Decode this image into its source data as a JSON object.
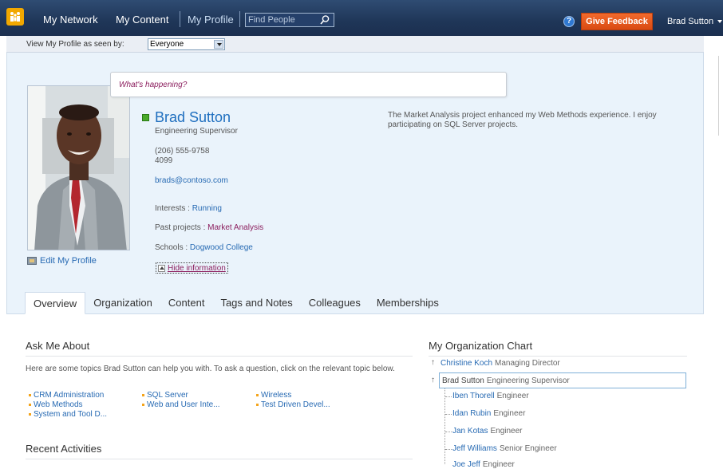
{
  "topnav": {
    "links": [
      "My Network",
      "My Content",
      "My Profile"
    ],
    "find_placeholder": "Find People",
    "feedback": "Give Feedback",
    "user": "Brad Sutton",
    "help": "?"
  },
  "subbar": {
    "label": "View My Profile as seen by:",
    "selected": "Everyone"
  },
  "status_bubble": "What's happening?",
  "profile": {
    "name": "Brad Sutton",
    "title": "Engineering Supervisor",
    "phone": "(206) 555-9758",
    "extension": "4099",
    "email": "brads@contoso.com",
    "interests_label": "Interests :",
    "interests_value": "Running",
    "past_projects_label": "Past projects :",
    "past_projects_value": "Market Analysis",
    "schools_label": "Schools :",
    "schools_value": "Dogwood College",
    "hide_info": "Hide information",
    "edit_profile": "Edit My Profile",
    "about": "The Market Analysis project enhanced my Web Methods experience. I enjoy participating on SQL Server projects."
  },
  "tabs": [
    "Overview",
    "Organization",
    "Content",
    "Tags and Notes",
    "Colleagues",
    "Memberships"
  ],
  "ask_me_about": {
    "title": "Ask Me About",
    "description": "Here are some topics Brad Sutton can help you with. To ask a question, click on the relevant topic below.",
    "topics": [
      "CRM Administration",
      "Web Methods",
      "System and Tool D...",
      "SQL Server",
      "Web and User Inte...",
      "Wireless",
      "Test Driven Devel..."
    ]
  },
  "recent_activities": {
    "title": "Recent Activities"
  },
  "org_chart": {
    "title": "My Organization Chart",
    "manager": {
      "name": "Christine Koch",
      "title": "Managing Director"
    },
    "self": {
      "name": "Brad Sutton",
      "title": "Engineering Supervisor"
    },
    "reports": [
      {
        "name": "Iben Thorell",
        "title": "Engineer"
      },
      {
        "name": "Idan Rubin",
        "title": "Engineer"
      },
      {
        "name": "Jan Kotas",
        "title": "Engineer"
      },
      {
        "name": "Jeff Williams",
        "title": "Senior Engineer"
      },
      {
        "name": "Joe Jeff",
        "title": "Engineer"
      }
    ]
  }
}
